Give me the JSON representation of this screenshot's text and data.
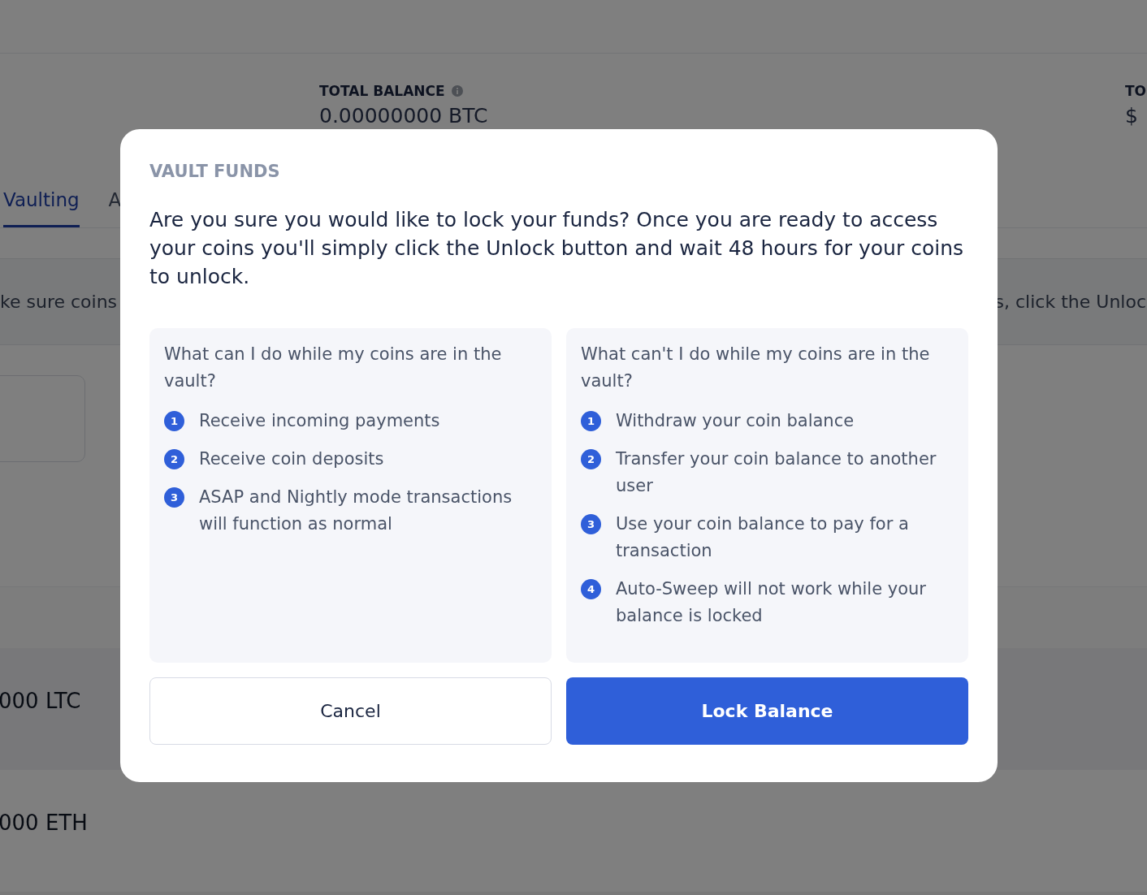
{
  "background": {
    "total_balance": {
      "label": "TOTAL BALANCE",
      "value": "0.00000000 BTC"
    },
    "second_balance": {
      "label": "TO",
      "value": "$"
    },
    "tabs": [
      {
        "label": "Vaulting",
        "selected": true
      },
      {
        "label": "A",
        "selected": false
      }
    ],
    "banner": {
      "text_left": "ke sure coins",
      "text_right": "s, click the Unloc"
    },
    "coins": [
      {
        "amount": "000 LTC"
      },
      {
        "amount": "000 ETH"
      }
    ]
  },
  "dialog": {
    "title": "VAULT FUNDS",
    "message": "Are you sure you would like to lock your funds? Once you are ready to access your coins you'll simply click the Unlock button and wait 48 hours for your coins to unlock.",
    "columns": [
      {
        "heading": "What can I do while my coins are in the vault?",
        "items": [
          {
            "number": "1",
            "text": "Receive incoming payments"
          },
          {
            "number": "2",
            "text": "Receive coin deposits"
          },
          {
            "number": "3",
            "text": "ASAP and Nightly mode transactions will function as normal"
          }
        ]
      },
      {
        "heading": "What can't I do while my coins are in the vault?",
        "items": [
          {
            "number": "1",
            "text": "Withdraw your coin balance"
          },
          {
            "number": "2",
            "text": "Transfer your coin balance to another user"
          },
          {
            "number": "3",
            "text": "Use your coin balance to pay for a transaction"
          },
          {
            "number": "4",
            "text": "Auto-Sweep will not work while your balance is locked"
          }
        ]
      }
    ],
    "buttons": [
      {
        "label": "Cancel",
        "kind": "secondary"
      },
      {
        "label": "Lock Balance",
        "kind": "primary"
      }
    ]
  }
}
